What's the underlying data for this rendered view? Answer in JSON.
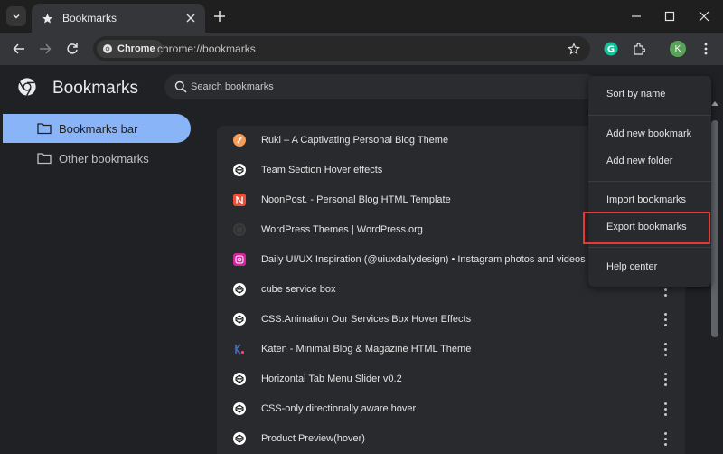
{
  "tab": {
    "title": "Bookmarks"
  },
  "toolbar": {
    "chip_label": "Chrome",
    "url": "chrome://bookmarks",
    "avatar_letter": "K"
  },
  "header": {
    "title": "Bookmarks",
    "search_placeholder": "Search bookmarks"
  },
  "sidebar": {
    "items": [
      {
        "label": "Bookmarks bar",
        "selected": true
      },
      {
        "label": "Other bookmarks",
        "selected": false
      }
    ]
  },
  "bookmarks": [
    {
      "title": "Ruki – A Captivating Personal Blog Theme",
      "icon": "ruki-favicon",
      "color": "#f59e5b"
    },
    {
      "title": "Team Section Hover effects",
      "icon": "codepen-icon",
      "color": "#ffffff"
    },
    {
      "title": "NoonPost. - Personal Blog HTML Template",
      "icon": "noonpost-favicon",
      "color": "#e8503a"
    },
    {
      "title": "WordPress Themes | WordPress.org",
      "icon": "wordpress-icon",
      "color": "#3c3c3c"
    },
    {
      "title": "Daily UI/UX Inspiration (@uiuxdailydesign) • Instagram photos and videos",
      "icon": "instagram-icon",
      "color": "#d6249f"
    },
    {
      "title": "cube service box",
      "icon": "codepen-icon",
      "color": "#ffffff"
    },
    {
      "title": "CSS:Animation Our Services Box Hover Effects",
      "icon": "codepen-icon",
      "color": "#ffffff"
    },
    {
      "title": "Katen - Minimal Blog & Magazine HTML Theme",
      "icon": "katen-favicon",
      "color": "#fe4f70"
    },
    {
      "title": "Horizontal Tab Menu Slider v0.2",
      "icon": "codepen-icon",
      "color": "#ffffff"
    },
    {
      "title": "CSS-only directionally aware hover",
      "icon": "codepen-icon",
      "color": "#ffffff"
    },
    {
      "title": "Product Preview(hover)",
      "icon": "codepen-icon",
      "color": "#ffffff"
    }
  ],
  "menu": {
    "items": [
      "Sort by name",
      "Add new bookmark",
      "Add new folder",
      "Import bookmarks",
      "Export bookmarks",
      "Help center"
    ],
    "highlighted": "Export bookmarks"
  },
  "colors": {
    "accent": "#8ab4f8",
    "highlight_box": "#e53935"
  }
}
